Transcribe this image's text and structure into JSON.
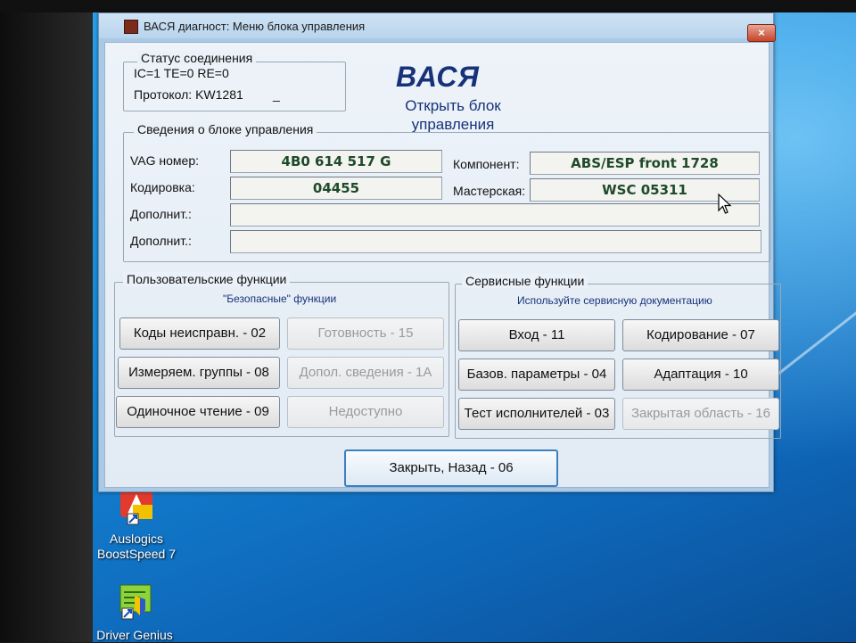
{
  "window": {
    "title": "ВАСЯ диагност: Меню блока управления",
    "close_label": "×"
  },
  "status": {
    "legend": "Статус соединения",
    "counters": "IC=1  TE=0   RE=0",
    "protocol_label": "Протокол: KW1281",
    "cursor_char": "_"
  },
  "logo": {
    "title": "ВАСЯ",
    "subtitle": "Открыть блок управления"
  },
  "info": {
    "legend": "Сведения о блоке управления",
    "vag_label": "VAG номер:",
    "vag_value": "4B0 614 517 G",
    "component_label": "Компонент:",
    "component_value": "ABS/ESP front        1728",
    "coding_label": "Кодировка:",
    "coding_value": "04455",
    "workshop_label": "Мастерская:",
    "workshop_value": "WSC 05311",
    "extra1_label": "Дополнит.:",
    "extra1_value": "",
    "extra2_label": "Дополнит.:",
    "extra2_value": ""
  },
  "user_functions": {
    "legend": "Пользовательские функции",
    "note": "\"Безопасные\" функции",
    "buttons": [
      {
        "label": "Коды неисправн. - 02",
        "enabled": true
      },
      {
        "label": "Готовность - 15",
        "enabled": false
      },
      {
        "label": "Измеряем. группы - 08",
        "enabled": true
      },
      {
        "label": "Допол. сведения - 1A",
        "enabled": false
      },
      {
        "label": "Одиночное чтение - 09",
        "enabled": true
      },
      {
        "label": "Недоступно",
        "enabled": false
      }
    ]
  },
  "service_functions": {
    "legend": "Сервисные функции",
    "note": "Используйте сервисную документацию",
    "buttons": [
      {
        "label": "Вход - 11",
        "enabled": true
      },
      {
        "label": "Кодирование - 07",
        "enabled": true
      },
      {
        "label": "Базов. параметры - 04",
        "enabled": true
      },
      {
        "label": "Адаптация - 10",
        "enabled": true
      },
      {
        "label": "Тест исполнителей - 03",
        "enabled": true
      },
      {
        "label": "Закрытая область - 16",
        "enabled": false
      }
    ]
  },
  "close_back_label": "Закрыть, Назад - 06",
  "desktop_icons": [
    {
      "label": "Auslogics BoostSpeed 7"
    },
    {
      "label": "Driver Genius"
    }
  ],
  "colors": {
    "window_bg": "#edf3f9",
    "logo": "#17327a",
    "value_text": "#1f4a2a",
    "desktop": "#1486d6"
  }
}
